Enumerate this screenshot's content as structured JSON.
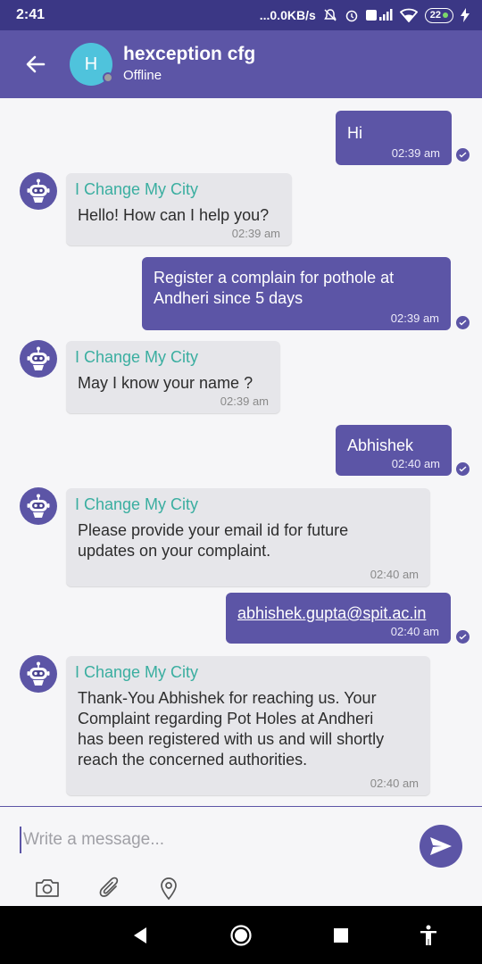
{
  "status": {
    "time": "2:41",
    "net_speed": "...0.0KB/s",
    "battery": "22"
  },
  "header": {
    "avatar_letter": "H",
    "title": "hexception cfg",
    "subtitle": "Offline"
  },
  "messages": [
    {
      "side": "out",
      "text": "Hi",
      "time": "02:39 am"
    },
    {
      "side": "in",
      "sender": "I Change My City",
      "text": "Hello! How can I help you?",
      "time": "02:39 am"
    },
    {
      "side": "out",
      "text_line1": "Register a complain for pothole at",
      "text_line2": "Andheri since 5 days",
      "time": "02:39 am"
    },
    {
      "side": "in",
      "sender": "I Change My City",
      "text": "May I know your name  ?",
      "time": "02:39 am"
    },
    {
      "side": "out",
      "text": "Abhishek",
      "time": "02:40 am"
    },
    {
      "side": "in",
      "sender": "I Change My City",
      "text_line1": "Please provide your email id for future",
      "text_line2": "updates on your complaint.",
      "time": "02:40 am"
    },
    {
      "side": "out",
      "text": "abhishek.gupta@spit.ac.in",
      "time": "02:40 am"
    },
    {
      "side": "in",
      "sender": "I Change My City",
      "text_line1": "Thank-You Abhishek for reaching us. Your",
      "text_line2": "Complaint regarding Pot Holes at  Andheri",
      "text_line3": "has been registered with us and will shortly",
      "text_line4": "reach the concerned authorities.",
      "time": "02:40 am"
    }
  ],
  "composer": {
    "placeholder": "Write a message..."
  },
  "colors": {
    "primary": "#5c55a6",
    "status_bar": "#3b3785",
    "sender_name": "#3aaea0",
    "incoming_bubble": "#e6e6ea",
    "avatar": "#4fc3dc"
  },
  "icons": [
    "back-arrow-icon",
    "bot-icon",
    "read-tick-icon",
    "send-icon",
    "camera-icon",
    "paperclip-icon",
    "location-pin-icon"
  ]
}
